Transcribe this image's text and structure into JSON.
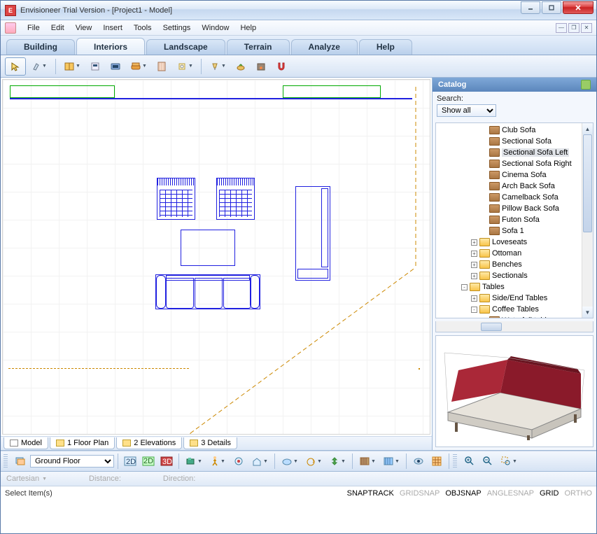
{
  "title": "Envisioneer Trial Version - [Project1 - Model]",
  "menu": [
    "File",
    "Edit",
    "View",
    "Insert",
    "Tools",
    "Settings",
    "Window",
    "Help"
  ],
  "mainTabs": [
    "Building",
    "Interiors",
    "Landscape",
    "Terrain",
    "Analyze",
    "Help"
  ],
  "activeMainTab": 1,
  "catalog": {
    "title": "Catalog",
    "searchLabel": "Search:",
    "filter": "Show all",
    "tree": [
      {
        "depth": 4,
        "icon": "obj",
        "label": "Club Sofa"
      },
      {
        "depth": 4,
        "icon": "obj",
        "label": "Sectional Sofa"
      },
      {
        "depth": 4,
        "icon": "obj",
        "label": "Sectional Sofa Left",
        "selected": true
      },
      {
        "depth": 4,
        "icon": "obj",
        "label": "Sectional Sofa Right"
      },
      {
        "depth": 4,
        "icon": "obj",
        "label": "Cinema Sofa"
      },
      {
        "depth": 4,
        "icon": "obj",
        "label": "Arch Back Sofa"
      },
      {
        "depth": 4,
        "icon": "obj",
        "label": "Camelback Sofa"
      },
      {
        "depth": 4,
        "icon": "obj",
        "label": "Pillow Back Sofa"
      },
      {
        "depth": 4,
        "icon": "obj",
        "label": "Futon Sofa"
      },
      {
        "depth": 4,
        "icon": "obj",
        "label": "Sofa 1"
      },
      {
        "depth": 3,
        "pm": "+",
        "icon": "folder",
        "label": "Loveseats"
      },
      {
        "depth": 3,
        "pm": "+",
        "icon": "folder",
        "label": "Ottoman"
      },
      {
        "depth": 3,
        "pm": "+",
        "icon": "folder",
        "label": "Benches"
      },
      {
        "depth": 3,
        "pm": "+",
        "icon": "folder",
        "label": "Sectionals"
      },
      {
        "depth": 2,
        "pm": "-",
        "icon": "folder",
        "label": "Tables"
      },
      {
        "depth": 3,
        "pm": "+",
        "icon": "folder",
        "label": "Side/End Tables"
      },
      {
        "depth": 3,
        "pm": "-",
        "icon": "folder",
        "label": "Coffee Tables"
      },
      {
        "depth": 4,
        "icon": "obj",
        "label": "Waterfall table"
      }
    ]
  },
  "viewTabs": [
    {
      "label": "Model",
      "active": true,
      "noIcon": true
    },
    {
      "label": "1 Floor Plan"
    },
    {
      "label": "2 Elevations"
    },
    {
      "label": "3 Details"
    }
  ],
  "floor": "Ground Floor",
  "infoBar": {
    "coord": "Cartesian",
    "dist": "Distance:",
    "dir": "Direction:"
  },
  "status": {
    "left": "Select Item(s)",
    "snaps": [
      {
        "t": "SNAPTRACK",
        "on": true
      },
      {
        "t": "GRIDSNAP",
        "on": false
      },
      {
        "t": "OBJSNAP",
        "on": true
      },
      {
        "t": "ANGLESNAP",
        "on": false
      },
      {
        "t": "GRID",
        "on": true
      },
      {
        "t": "ORTHO",
        "on": false
      }
    ]
  }
}
